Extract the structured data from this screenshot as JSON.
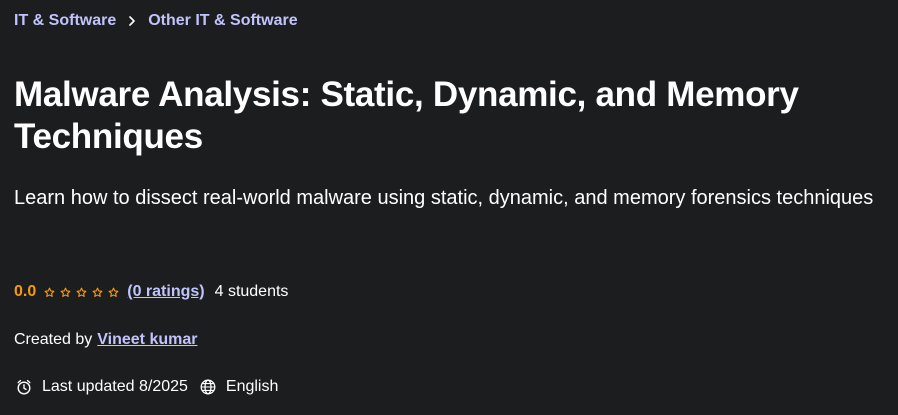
{
  "breadcrumb": {
    "items": [
      {
        "label": "IT & Software"
      },
      {
        "label": "Other IT & Software"
      }
    ],
    "separator_icon": "chevron-right-icon"
  },
  "course": {
    "title": "Malware Analysis: Static, Dynamic, and Memory Techniques",
    "subtitle": "Learn how to dissect real-world malware using static, dynamic, and memory forensics techniques",
    "rating": {
      "value": "0.0",
      "stars_filled": 0,
      "stars_total": 5,
      "ratings_link": "(0 ratings)",
      "students": "4 students"
    },
    "creator": {
      "label": "Created by",
      "name": "Vineet kumar"
    },
    "meta": {
      "last_updated": "Last updated 8/2025",
      "language": "English",
      "clock_icon": "alarm-clock-icon",
      "language_icon": "globe-icon"
    }
  },
  "colors": {
    "background": "#1c1d1f",
    "link": "#c0c4fc",
    "rating": "#f69c08",
    "text": "#ffffff"
  }
}
